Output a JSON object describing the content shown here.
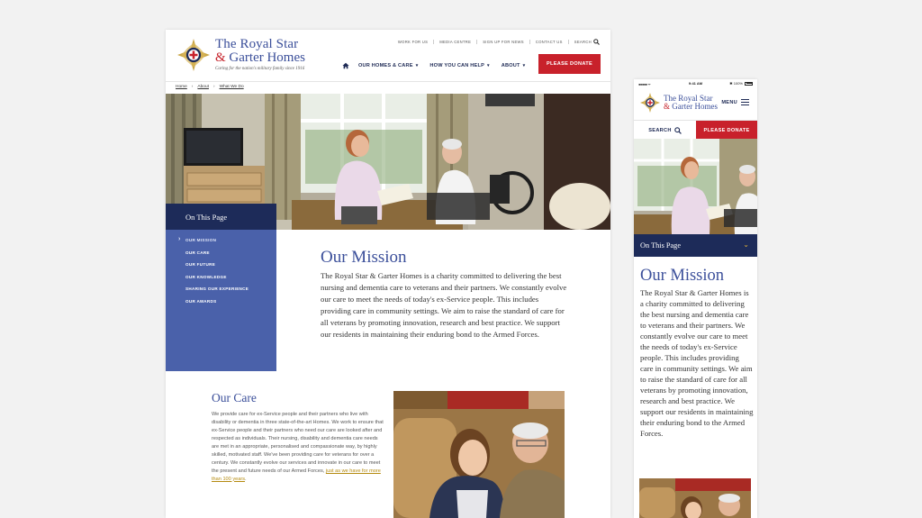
{
  "brand": {
    "name_line1": "The Royal Star",
    "name_amp": "&",
    "name_line2": " Garter Homes",
    "tagline": "Caring for the nation's military family since 1916"
  },
  "desktop": {
    "utility_nav": [
      "WORK FOR US",
      "MEDIA CENTRE",
      "SIGN UP FOR NEWS",
      "CONTACT US"
    ],
    "search_label": "SEARCH",
    "main_nav": [
      {
        "label": "OUR HOMES & CARE"
      },
      {
        "label": "HOW YOU CAN HELP"
      },
      {
        "label": "ABOUT"
      }
    ],
    "donate_label": "PLEASE DONATE",
    "breadcrumbs": [
      "Home",
      "About",
      "What We Do"
    ],
    "sidebar": {
      "heading": "On This Page",
      "items": [
        "OUR MISSION",
        "OUR CARE",
        "OUR FUTURE",
        "OUR KNOWLEDGE",
        "SHARING OUR EXPERIENCE",
        "OUR AWARDS"
      ]
    },
    "mission": {
      "title": "Our Mission",
      "body": "The Royal Star & Garter Homes is a charity committed to delivering the best nursing and dementia care to veterans and their partners. We constantly evolve our care to meet the needs of today's ex-Service people. This includes providing care in community settings. We aim to raise the standard of care for all veterans by promoting innovation, research and best practice. We support our residents in maintaining their enduring bond to the Armed Forces."
    },
    "care": {
      "title": "Our Care",
      "body": "We provide care for ex-Service people and their partners who live with disability or dementia in three state-of-the-art Homes. We work to ensure that ex-Service people and their partners who need our care are looked after and respected as individuals. Their nursing, disability and dementia care needs are met in an appropriate, personalised and compassionate way, by highly skilled, motivated staff. We've been providing care for veterans for over a century. We constantly evolve our services and innovate in our care to meet the present and future needs of our Armed Forces, ",
      "link": "just as we have for more than 100 years",
      "end": "."
    }
  },
  "mobile": {
    "status": {
      "signal": "●●●●● ᯤ",
      "time": "9:41 AM",
      "battery": "✱ 100%"
    },
    "brand_line1": "The Royal Star",
    "brand_amp": "&",
    "brand_line2": " Garter Homes",
    "menu_label": "MENU",
    "search_label": "SEARCH",
    "donate_label": "PLEASE DONATE",
    "on_this_page": "On This Page",
    "mission_title": "Our Mission",
    "mission_body": "The Royal Star & Garter Homes is a charity committed to delivering the best nursing and dementia care to veterans and their partners. We constantly evolve our care to meet the needs of today's ex-Service people. This includes providing care in community settings. We aim to raise the standard of care for all veterans by promoting innovation, research and best practice. We support our residents in maintaining their enduring bond to the Armed Forces."
  },
  "colors": {
    "navy": "#1d2b59",
    "royal_blue": "#4a61aa",
    "brand_blue": "#3b4f9a",
    "red": "#c8212b",
    "link_gold": "#b58b10"
  }
}
